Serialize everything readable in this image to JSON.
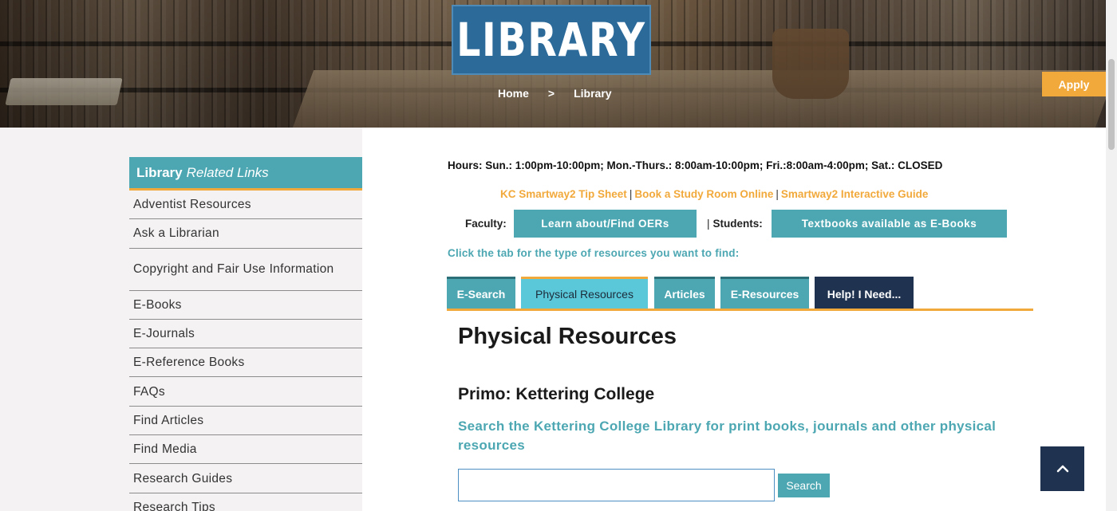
{
  "hero": {
    "banner_text": "LIBRARY",
    "breadcrumb": {
      "home": "Home",
      "separator": ">",
      "current": "Library"
    },
    "apply_label": "Apply"
  },
  "sidebar": {
    "header_strong": "Library",
    "header_em": "Related Links",
    "items": [
      {
        "label": "Adventist Resources"
      },
      {
        "label": "Ask a Librarian"
      },
      {
        "label": "Copyright and Fair Use Information"
      },
      {
        "label": "E-Books"
      },
      {
        "label": "E-Journals"
      },
      {
        "label": "E-Reference Books"
      },
      {
        "label": "FAQs"
      },
      {
        "label": "Find Articles"
      },
      {
        "label": "Find Media"
      },
      {
        "label": "Research Guides"
      },
      {
        "label": "Research Tips"
      }
    ]
  },
  "main": {
    "hours": "Hours: Sun.: 1:00pm-10:00pm; Mon.-Thurs.: 8:00am-10:00pm; Fri.:8:00am-4:00pm; Sat.: CLOSED",
    "quicklinks": {
      "tip_sheet": "KC Smartway2 Tip Sheet",
      "study_room": "Book a Study Room Online",
      "guide": "Smartway2 Interactive Guide",
      "separator": "|"
    },
    "faculty_label": "Faculty:",
    "oer_button": "Learn about/Find OERs",
    "students_pipe": "|",
    "students_label": "Students:",
    "ebooks_button": "Textbooks available as E-Books",
    "instruction": "Click the tab for the type of resources you want to find:",
    "tabs": [
      {
        "label": "E-Search"
      },
      {
        "label": "Physical Resources"
      },
      {
        "label": "Articles"
      },
      {
        "label": "E-Resources"
      },
      {
        "label": "Help! I Need..."
      }
    ],
    "panel_title": "Physical Resources",
    "primo_title": "Primo: Kettering College",
    "primo_desc": "Search the Kettering College Library for print books, journals and other physical resources",
    "search": {
      "value": "",
      "button": "Search"
    }
  },
  "colors": {
    "teal": "#4ca7b2",
    "light_teal": "#5bc8d9",
    "orange": "#f2a93b",
    "navy": "#1f3250",
    "banner_blue": "#2c6a9a"
  },
  "icons": {
    "back_to_top": "chevron-up-icon"
  }
}
